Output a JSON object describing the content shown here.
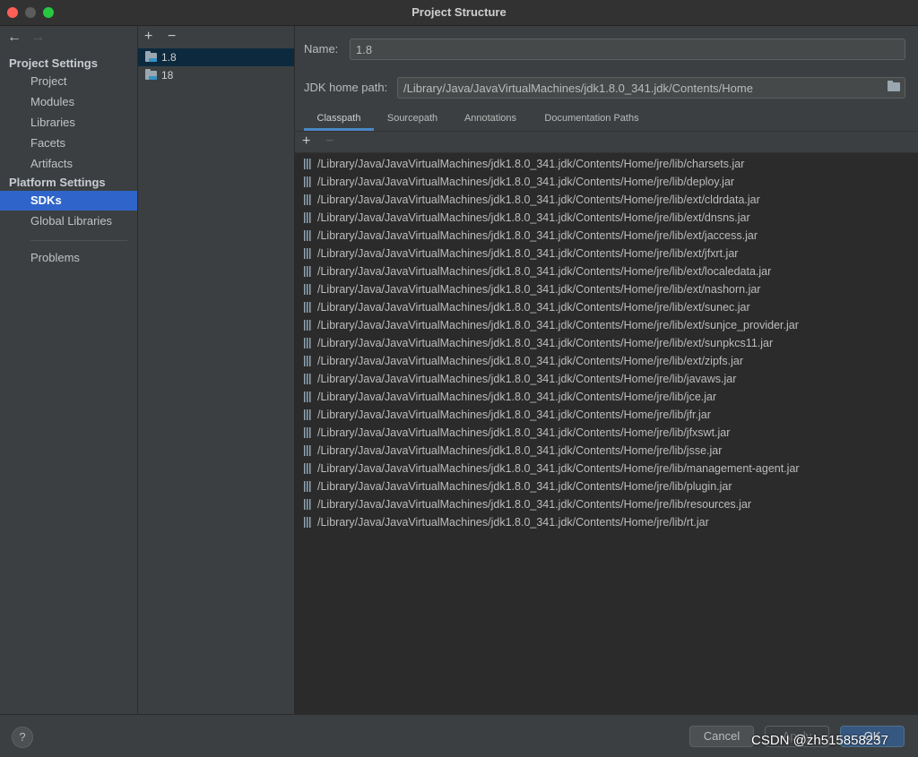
{
  "window": {
    "title": "Project Structure"
  },
  "nav": {
    "back_icon": "←",
    "forward_icon": "→"
  },
  "sidebar": {
    "project_settings_header": "Project Settings",
    "project_items": [
      "Project",
      "Modules",
      "Libraries",
      "Facets",
      "Artifacts"
    ],
    "platform_settings_header": "Platform Settings",
    "platform_items": [
      "SDKs",
      "Global Libraries"
    ],
    "selected": "SDKs",
    "problems": "Problems"
  },
  "sdk_list": {
    "add_icon": "+",
    "remove_icon": "−",
    "items": [
      "1.8",
      "18"
    ],
    "selected": "1.8"
  },
  "details": {
    "name_label": "Name:",
    "name_value": "1.8",
    "jdk_home_label": "JDK home path:",
    "jdk_home_value": "/Library/Java/JavaVirtualMachines/jdk1.8.0_341.jdk/Contents/Home",
    "tabs": [
      "Classpath",
      "Sourcepath",
      "Annotations",
      "Documentation Paths"
    ],
    "selected_tab": "Classpath",
    "add_icon": "+",
    "remove_icon": "−",
    "classpath": [
      "/Library/Java/JavaVirtualMachines/jdk1.8.0_341.jdk/Contents/Home/jre/lib/charsets.jar",
      "/Library/Java/JavaVirtualMachines/jdk1.8.0_341.jdk/Contents/Home/jre/lib/deploy.jar",
      "/Library/Java/JavaVirtualMachines/jdk1.8.0_341.jdk/Contents/Home/jre/lib/ext/cldrdata.jar",
      "/Library/Java/JavaVirtualMachines/jdk1.8.0_341.jdk/Contents/Home/jre/lib/ext/dnsns.jar",
      "/Library/Java/JavaVirtualMachines/jdk1.8.0_341.jdk/Contents/Home/jre/lib/ext/jaccess.jar",
      "/Library/Java/JavaVirtualMachines/jdk1.8.0_341.jdk/Contents/Home/jre/lib/ext/jfxrt.jar",
      "/Library/Java/JavaVirtualMachines/jdk1.8.0_341.jdk/Contents/Home/jre/lib/ext/localedata.jar",
      "/Library/Java/JavaVirtualMachines/jdk1.8.0_341.jdk/Contents/Home/jre/lib/ext/nashorn.jar",
      "/Library/Java/JavaVirtualMachines/jdk1.8.0_341.jdk/Contents/Home/jre/lib/ext/sunec.jar",
      "/Library/Java/JavaVirtualMachines/jdk1.8.0_341.jdk/Contents/Home/jre/lib/ext/sunjce_provider.jar",
      "/Library/Java/JavaVirtualMachines/jdk1.8.0_341.jdk/Contents/Home/jre/lib/ext/sunpkcs11.jar",
      "/Library/Java/JavaVirtualMachines/jdk1.8.0_341.jdk/Contents/Home/jre/lib/ext/zipfs.jar",
      "/Library/Java/JavaVirtualMachines/jdk1.8.0_341.jdk/Contents/Home/jre/lib/javaws.jar",
      "/Library/Java/JavaVirtualMachines/jdk1.8.0_341.jdk/Contents/Home/jre/lib/jce.jar",
      "/Library/Java/JavaVirtualMachines/jdk1.8.0_341.jdk/Contents/Home/jre/lib/jfr.jar",
      "/Library/Java/JavaVirtualMachines/jdk1.8.0_341.jdk/Contents/Home/jre/lib/jfxswt.jar",
      "/Library/Java/JavaVirtualMachines/jdk1.8.0_341.jdk/Contents/Home/jre/lib/jsse.jar",
      "/Library/Java/JavaVirtualMachines/jdk1.8.0_341.jdk/Contents/Home/jre/lib/management-agent.jar",
      "/Library/Java/JavaVirtualMachines/jdk1.8.0_341.jdk/Contents/Home/jre/lib/plugin.jar",
      "/Library/Java/JavaVirtualMachines/jdk1.8.0_341.jdk/Contents/Home/jre/lib/resources.jar",
      "/Library/Java/JavaVirtualMachines/jdk1.8.0_341.jdk/Contents/Home/jre/lib/rt.jar"
    ]
  },
  "footer": {
    "help_label": "?",
    "cancel_label": "Cancel",
    "apply_label": "Apply",
    "ok_label": "OK"
  },
  "watermark": "CSDN @zh515858237",
  "colors": {
    "selection": "#2f65ca",
    "panel_bg": "#3c3f41",
    "list_bg": "#2b2b2b",
    "ok_button": "#365880",
    "tab_underline": "#4a88c7"
  }
}
